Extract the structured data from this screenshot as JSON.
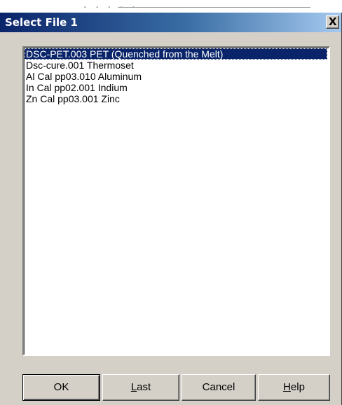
{
  "window": {
    "title": "Select File 1",
    "close_glyph": "X"
  },
  "file_list": {
    "items": [
      {
        "label": "DSC-PET.003  PET (Quenched from the Melt)",
        "selected": true
      },
      {
        "label": "Dsc-cure.001  Thermoset",
        "selected": false
      },
      {
        "label": "Al Cal pp03.010  Aluminum",
        "selected": false
      },
      {
        "label": "In Cal pp02.001  Indium",
        "selected": false
      },
      {
        "label": "Zn Cal pp03.001  Zinc",
        "selected": false
      }
    ]
  },
  "buttons": {
    "ok": {
      "label": "OK"
    },
    "last": {
      "mnemonic": "L",
      "rest": "ast"
    },
    "cancel": {
      "label": "Cancel"
    },
    "help": {
      "mnemonic": "H",
      "rest": "elp"
    }
  },
  "colors": {
    "face": "#d4d0c8",
    "title_start": "#0a246a",
    "title_end": "#a6caf0",
    "selection": "#0a246a"
  }
}
